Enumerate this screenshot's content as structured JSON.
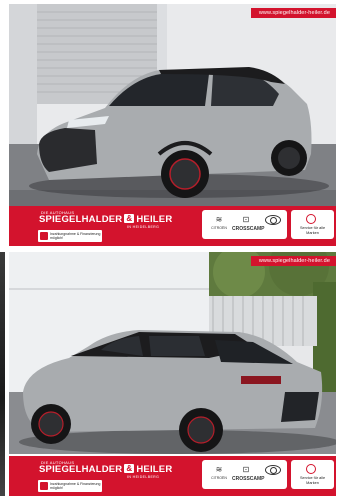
{
  "listings": [
    {
      "url": "www.spiegelhalder-heiler.de",
      "banner": {
        "brand_prefix": "DIE AUTOHAUS",
        "brand_name_a": "SPIEGELHALDER",
        "brand_amp": "&",
        "brand_name_b": "HEILER",
        "brand_sub": "IN HEIDELBERG",
        "finance_text": "Inzahlungnahme & Finanzierung möglich!",
        "logos": [
          {
            "name": "citroen-logo",
            "symbol": "≋",
            "label": "CITROËN"
          },
          {
            "name": "crosscamp-logo",
            "symbol": "⊡",
            "label": "CROSSCAMP"
          },
          {
            "name": "toyota-logo",
            "symbol": "",
            "label": ""
          }
        ],
        "service_text": "Service für alle Marken"
      }
    },
    {
      "url": "www.spiegelhalder-heiler.de",
      "banner": {
        "brand_prefix": "DIE AUTOHAUS",
        "brand_name_a": "SPIEGELHALDER",
        "brand_amp": "&",
        "brand_name_b": "HEILER",
        "brand_sub": "IN HEIDELBERG",
        "finance_text": "Inzahlungnahme & Finanzierung möglich!",
        "logos": [
          {
            "name": "citroen-logo",
            "symbol": "≋",
            "label": "CITROËN"
          },
          {
            "name": "crosscamp-logo",
            "symbol": "⊡",
            "label": "CROSSCAMP"
          },
          {
            "name": "toyota-logo",
            "symbol": "",
            "label": ""
          }
        ],
        "service_text": "Service für alle Marken"
      }
    }
  ],
  "colors": {
    "brand_red": "#d3132d",
    "car_silver": "#a9acaf",
    "car_roof": "#1c1c1e"
  }
}
